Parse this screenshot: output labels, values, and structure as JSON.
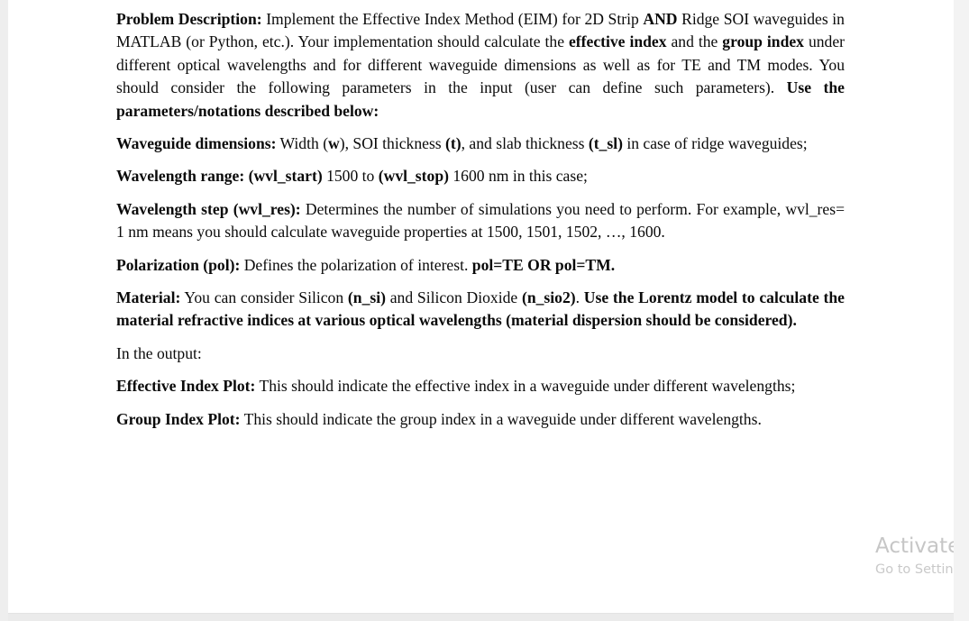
{
  "document": {
    "page_background": "#ffffff",
    "gutter_color": "#eeeeee",
    "text_color": "#0a0a0a",
    "paragraphs": [
      {
        "id": "problem-description",
        "lead_label": "Problem Description:",
        "runs": [
          {
            "text": "Problem Description:",
            "bold": true
          },
          {
            "text": " Implement the Effective Index Method (EIM) for 2D Strip ",
            "bold": false
          },
          {
            "text": "AND",
            "bold": true
          },
          {
            "text": " Ridge SOI waveguides in MATLAB (or Python, etc.). Your implementation should calculate the ",
            "bold": false
          },
          {
            "text": "effective index",
            "bold": true
          },
          {
            "text": " and the ",
            "bold": false
          },
          {
            "text": "group index",
            "bold": true
          },
          {
            "text": " under different optical wavelengths and for different waveguide dimensions as well as for TE and TM modes. You should consider the following parameters in the input (user can define such parameters). ",
            "bold": false
          },
          {
            "text": "Use the parameters/notations described below:",
            "bold": true
          }
        ]
      },
      {
        "id": "waveguide-dimensions",
        "lead_label": "Waveguide dimensions:",
        "runs": [
          {
            "text": "Waveguide dimensions:",
            "bold": true
          },
          {
            "text": " Width (",
            "bold": false
          },
          {
            "text": "w",
            "bold": true
          },
          {
            "text": "), SOI thickness ",
            "bold": false
          },
          {
            "text": "(t)",
            "bold": true
          },
          {
            "text": ", and slab thickness ",
            "bold": false
          },
          {
            "text": "(t_sl)",
            "bold": true
          },
          {
            "text": " in case of ridge waveguides;",
            "bold": false
          }
        ]
      },
      {
        "id": "wavelength-range",
        "lead_label": "Wavelength range:",
        "runs": [
          {
            "text": "Wavelength range: (wvl_start)",
            "bold": true
          },
          {
            "text": " 1500 to ",
            "bold": false
          },
          {
            "text": "(wvl_stop)",
            "bold": true
          },
          {
            "text": " 1600 nm in this case;",
            "bold": false
          }
        ]
      },
      {
        "id": "wavelength-step",
        "lead_label": "Wavelength step (wvl_res):",
        "runs": [
          {
            "text": "Wavelength step (wvl_res):",
            "bold": true
          },
          {
            "text": " Determines the number of simulations you need to perform. For example, wvl_res= 1 nm means you should calculate waveguide properties at 1500, 1501, 1502, …, 1600.",
            "bold": false
          }
        ]
      },
      {
        "id": "polarization",
        "lead_label": "Polarization (pol):",
        "runs": [
          {
            "text": "Polarization (pol):",
            "bold": true
          },
          {
            "text": " Defines the polarization of interest. ",
            "bold": false
          },
          {
            "text": "pol=TE OR pol=TM.",
            "bold": true
          }
        ]
      },
      {
        "id": "material",
        "lead_label": "Material:",
        "runs": [
          {
            "text": "Material:",
            "bold": true
          },
          {
            "text": " You can consider Silicon ",
            "bold": false
          },
          {
            "text": "(n_si)",
            "bold": true
          },
          {
            "text": " and Silicon Dioxide ",
            "bold": false
          },
          {
            "text": "(n_sio2)",
            "bold": true
          },
          {
            "text": ". ",
            "bold": false
          },
          {
            "text": "Use the Lorentz model to calculate the material refractive indices at various optical wavelengths (material dispersion should be considered).",
            "bold": true
          }
        ]
      },
      {
        "id": "in-the-output",
        "lead_label": "",
        "runs": [
          {
            "text": "In the output:",
            "bold": false
          }
        ]
      },
      {
        "id": "effective-index-plot",
        "lead_label": "Effective Index Plot:",
        "runs": [
          {
            "text": "Effective Index Plot:",
            "bold": true
          },
          {
            "text": " This should indicate the effective index in a waveguide under different wavelengths;",
            "bold": false
          }
        ]
      },
      {
        "id": "group-index-plot",
        "lead_label": "Group Index Plot:",
        "runs": [
          {
            "text": "Group Index Plot:",
            "bold": true
          },
          {
            "text": " This should indicate the group index in a waveguide under different wavelengths.",
            "bold": false
          }
        ]
      }
    ]
  },
  "watermark": {
    "title": "Activate Windows",
    "subtitle": "Go to Settings to activate Windows.",
    "color": "#c8c8c8"
  }
}
